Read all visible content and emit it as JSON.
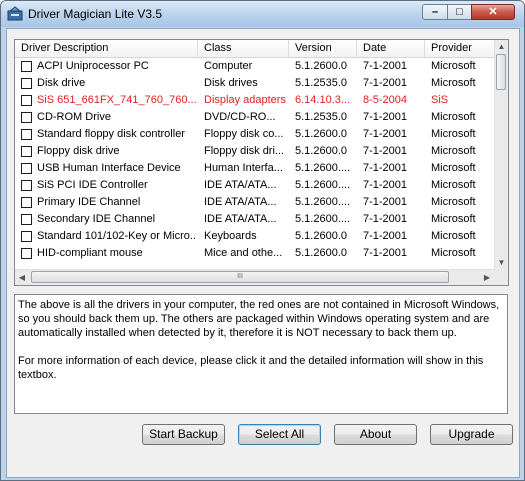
{
  "window": {
    "title": "Driver Magician Lite V3.5"
  },
  "window_controls": {
    "minimize": "–",
    "maximize": "□",
    "close": "✕"
  },
  "columns": [
    "Driver Description",
    "Class",
    "Version",
    "Date",
    "Provider"
  ],
  "drivers": [
    {
      "description": "ACPI Uniprocessor PC",
      "class": "Computer",
      "version": "5.1.2600.0",
      "date": "7-1-2001",
      "provider": "Microsoft",
      "non_microsoft": false
    },
    {
      "description": "Disk drive",
      "class": "Disk drives",
      "version": "5.1.2535.0",
      "date": "7-1-2001",
      "provider": "Microsoft",
      "non_microsoft": false
    },
    {
      "description": "SiS 651_661FX_741_760_760...",
      "class": "Display adapters",
      "version": "6.14.10.3...",
      "date": "8-5-2004",
      "provider": "SiS",
      "non_microsoft": true
    },
    {
      "description": "CD-ROM Drive",
      "class": "DVD/CD-RO...",
      "version": "5.1.2535.0",
      "date": "7-1-2001",
      "provider": "Microsoft",
      "non_microsoft": false
    },
    {
      "description": "Standard floppy disk controller",
      "class": "Floppy disk co...",
      "version": "5.1.2600.0",
      "date": "7-1-2001",
      "provider": "Microsoft",
      "non_microsoft": false
    },
    {
      "description": "Floppy disk drive",
      "class": "Floppy disk dri...",
      "version": "5.1.2600.0",
      "date": "7-1-2001",
      "provider": "Microsoft",
      "non_microsoft": false
    },
    {
      "description": "USB Human Interface Device",
      "class": "Human Interfa...",
      "version": "5.1.2600....",
      "date": "7-1-2001",
      "provider": "Microsoft",
      "non_microsoft": false
    },
    {
      "description": "SiS PCI IDE Controller",
      "class": "IDE ATA/ATA...",
      "version": "5.1.2600....",
      "date": "7-1-2001",
      "provider": "Microsoft",
      "non_microsoft": false
    },
    {
      "description": "Primary IDE Channel",
      "class": "IDE ATA/ATA...",
      "version": "5.1.2600....",
      "date": "7-1-2001",
      "provider": "Microsoft",
      "non_microsoft": false
    },
    {
      "description": "Secondary IDE Channel",
      "class": "IDE ATA/ATA...",
      "version": "5.1.2600....",
      "date": "7-1-2001",
      "provider": "Microsoft",
      "non_microsoft": false
    },
    {
      "description": "Standard 101/102-Key or Micro...",
      "class": "Keyboards",
      "version": "5.1.2600.0",
      "date": "7-1-2001",
      "provider": "Microsoft",
      "non_microsoft": false
    },
    {
      "description": "HID-compliant mouse",
      "class": "Mice and othe...",
      "version": "5.1.2600.0",
      "date": "7-1-2001",
      "provider": "Microsoft",
      "non_microsoft": false
    }
  ],
  "scrollbar": {
    "up": "▲",
    "down": "▼",
    "left": "◀",
    "right": "▶",
    "grip": "III"
  },
  "info_text": [
    "The above is all the drivers in your computer, the red ones are not contained in Microsoft Windows, so you should back them up. The others are packaged within Windows operating system and are automatically installed when detected by it, therefore it is NOT necessary to back them up.",
    "For more information of each device, please click it and the detailed information will show in this textbox."
  ],
  "buttons": {
    "start_backup": "Start Backup",
    "select_all": "Select All",
    "about": "About",
    "upgrade": "Upgrade"
  },
  "colors": {
    "non_microsoft_text": "#e02020",
    "title_bar": "#b9d1ec",
    "close_button": "#c9584b"
  }
}
